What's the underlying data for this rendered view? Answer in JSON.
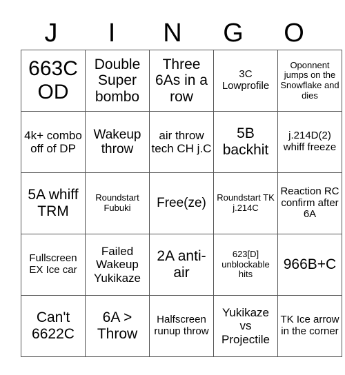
{
  "header": {
    "letters": [
      "J",
      "I",
      "N",
      "G",
      "O"
    ]
  },
  "rows": [
    [
      {
        "text": "663C OD",
        "size": "s1"
      },
      {
        "text": "Double Super bombo",
        "size": "s2"
      },
      {
        "text": "Three 6As in a row",
        "size": "s2"
      },
      {
        "text": "3C Lowprofile",
        "size": "s5"
      },
      {
        "text": "Oponnent jumps on the Snowflake and dies",
        "size": "s6"
      }
    ],
    [
      {
        "text": "4k+ combo off of DP",
        "size": "s4"
      },
      {
        "text": "Wakeup throw",
        "size": "s3"
      },
      {
        "text": "air throw tech CH j.C",
        "size": "s4"
      },
      {
        "text": "5B backhit",
        "size": "s2"
      },
      {
        "text": "j.214D(2) whiff freeze",
        "size": "s5"
      }
    ],
    [
      {
        "text": "5A whiff TRM",
        "size": "s2"
      },
      {
        "text": "Roundstart Fubuki",
        "size": "s6"
      },
      {
        "text": "Free(ze)",
        "size": "s3"
      },
      {
        "text": "Roundstart TK j.214C",
        "size": "s6"
      },
      {
        "text": "Reaction RC confirm after 6A",
        "size": "s5"
      }
    ],
    [
      {
        "text": "Fullscreen EX Ice car",
        "size": "s5"
      },
      {
        "text": "Failed Wakeup Yukikaze",
        "size": "s4"
      },
      {
        "text": "2A anti-air",
        "size": "s2"
      },
      {
        "text": "623[D] unblockable hits",
        "size": "s6"
      },
      {
        "text": "966B+C",
        "size": "s2"
      }
    ],
    [
      {
        "text": "Can't 6622C",
        "size": "s2"
      },
      {
        "text": "6A > Throw",
        "size": "s2"
      },
      {
        "text": "Halfscreen runup throw",
        "size": "s5"
      },
      {
        "text": "Yukikaze vs Projectile",
        "size": "s4"
      },
      {
        "text": "TK Ice arrow in the corner",
        "size": "s5"
      }
    ]
  ]
}
